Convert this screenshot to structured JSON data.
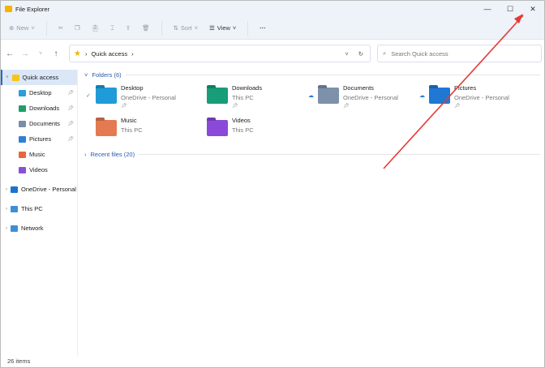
{
  "window": {
    "title": "File Explorer",
    "controls": [
      "—",
      "☐",
      "✕"
    ]
  },
  "toolbar": {
    "new": "New",
    "sort": "Sort",
    "view": "View",
    "more": "···"
  },
  "address": {
    "path": "Quick access",
    "search_placeholder": "Search Quick access"
  },
  "sidebar": {
    "items": [
      {
        "label": "Quick access",
        "color": "#f5c518",
        "level": 0,
        "selected": true
      },
      {
        "label": "Desktop",
        "color": "#2aa0d8",
        "level": 1,
        "pinned": true
      },
      {
        "label": "Downloads",
        "color": "#1e9e6a",
        "level": 1,
        "pinned": true
      },
      {
        "label": "Documents",
        "color": "#7b8ea8",
        "level": 1,
        "pinned": true
      },
      {
        "label": "Pictures",
        "color": "#2f7fd6",
        "level": 1,
        "pinned": true
      },
      {
        "label": "Music",
        "color": "#e8663d",
        "level": 1
      },
      {
        "label": "Videos",
        "color": "#8a4fd8",
        "level": 1
      },
      {
        "label": "OneDrive - Personal",
        "color": "#1a73d0",
        "level": 0
      },
      {
        "label": "This PC",
        "color": "#3c8fd6",
        "level": 0
      },
      {
        "label": "Network",
        "color": "#3c8fd6",
        "level": 0
      }
    ]
  },
  "folders_header": "Folders (6)",
  "folders": [
    {
      "name": "Desktop",
      "sub": "OneDrive - Personal",
      "color": "#1f9bd8",
      "pinned": true,
      "badge": "✓"
    },
    {
      "name": "Downloads",
      "sub": "This PC",
      "color": "#179d78",
      "pinned": true
    },
    {
      "name": "Documents",
      "sub": "OneDrive - Personal",
      "color": "#7d91ab",
      "pinned": true,
      "badge": "☁"
    },
    {
      "name": "Pictures",
      "sub": "OneDrive - Personal",
      "color": "#1e78d4",
      "pinned": true,
      "badge": "☁"
    },
    {
      "name": "Music",
      "sub": "This PC",
      "color": "#e47a52"
    },
    {
      "name": "Videos",
      "sub": "This PC",
      "color": "#8b49d8"
    }
  ],
  "recent_header": "Recent files (20)",
  "status": "26 items",
  "annotation": {
    "arrow_color": "#e53935"
  }
}
